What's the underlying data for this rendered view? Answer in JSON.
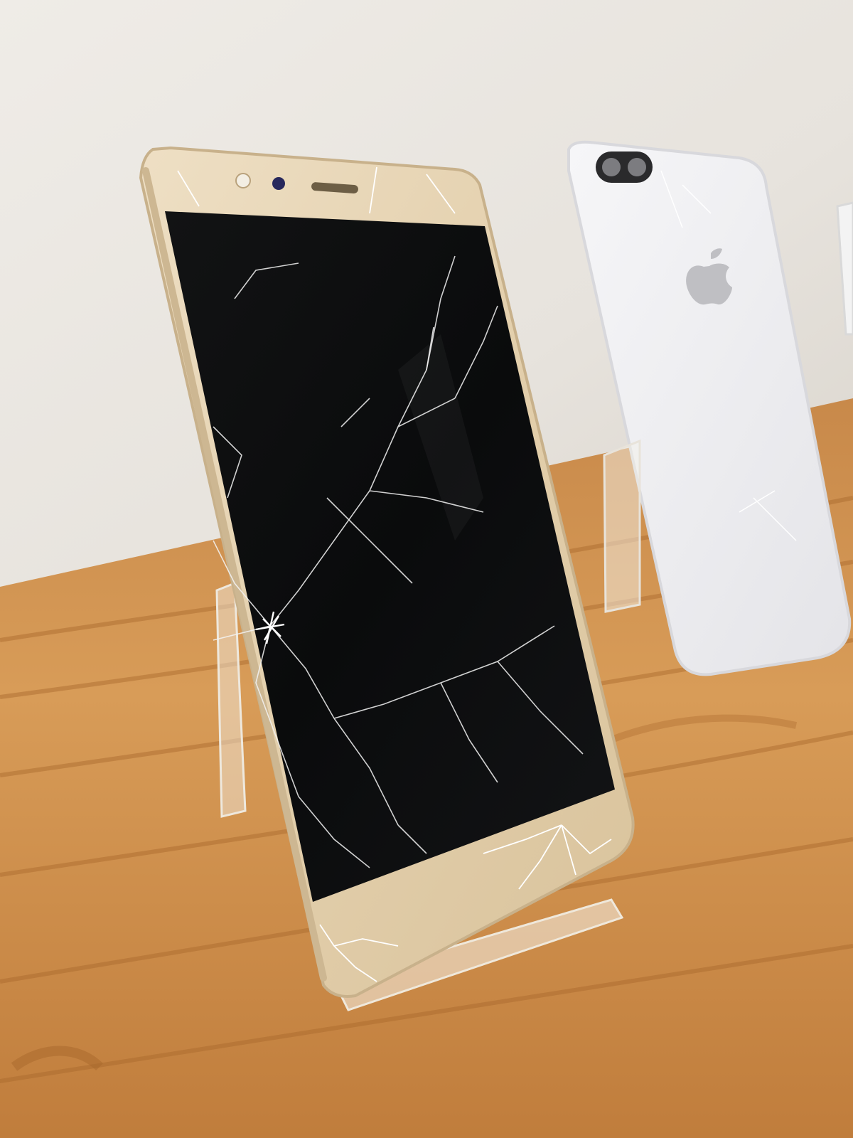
{
  "scene": {
    "subject": "cracked-phone",
    "colors": {
      "wall": "#ECE9E4",
      "wall_shadow": "#DCD8D1",
      "table": "#C98A45",
      "table_light": "#DDA25C",
      "table_dark": "#A8682C",
      "phone_frame": "#E6D3B3",
      "phone_bezel": "#D8C3A0",
      "screen": "#0B0C0D",
      "crack": "#F3F3F3",
      "white_phone": "#F2F2F4",
      "stand": "#F4F1EA"
    },
    "icons": [
      "apple-logo-icon",
      "camera-icon",
      "earpiece-icon",
      "proximity-sensor-icon"
    ]
  }
}
